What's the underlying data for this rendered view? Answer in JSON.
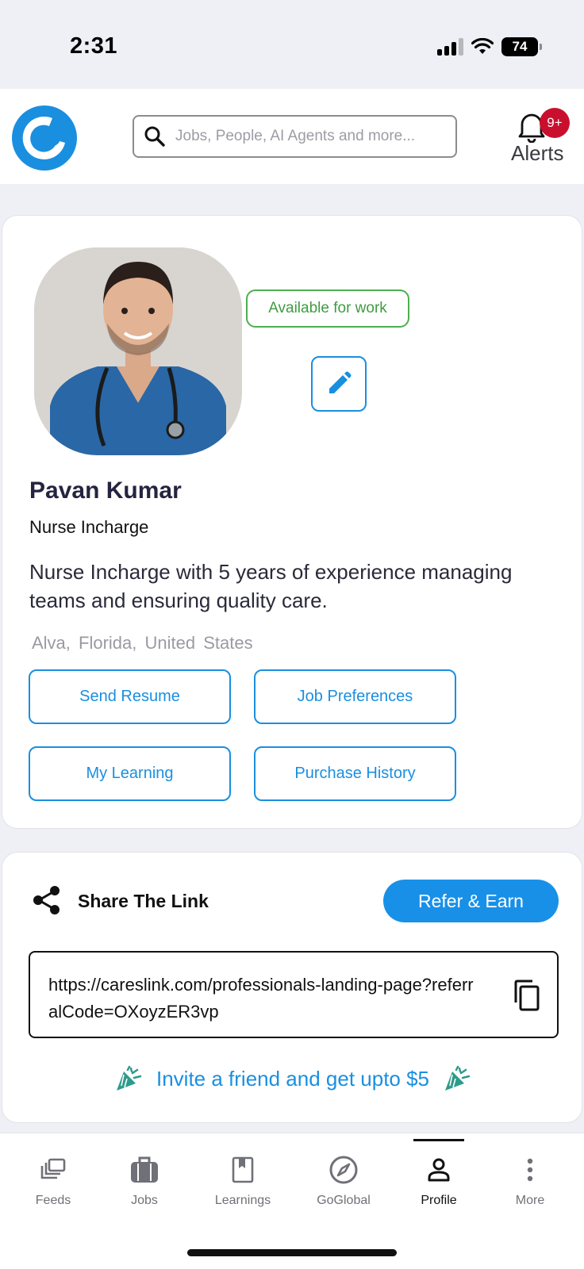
{
  "status_bar": {
    "time": "2:31",
    "battery": "74"
  },
  "header": {
    "search_placeholder": "Jobs, People, AI Agents and more...",
    "alerts_label": "Alerts",
    "alerts_badge": "9+"
  },
  "profile": {
    "availability": "Available for work",
    "name": "Pavan Kumar",
    "title": "Nurse Incharge",
    "bio": "Nurse Incharge with 5 years of experience managing teams and ensuring quality care.",
    "location": "Alva,  Florida,  United States",
    "actions": {
      "send_resume": "Send Resume",
      "job_preferences": "Job Preferences",
      "my_learning": "My Learning",
      "purchase_history": "Purchase History"
    }
  },
  "share": {
    "title": "Share The Link",
    "refer_button": "Refer & Earn",
    "link": "https://careslink.com/professionals-landing-page?referralCode=OXoyzER3vp",
    "invite_text": "Invite a friend and get upto $5"
  },
  "nav": {
    "feeds": "Feeds",
    "jobs": "Jobs",
    "learnings": "Learnings",
    "goglobal": "GoGlobal",
    "profile": "Profile",
    "more": "More"
  },
  "colors": {
    "brand_blue": "#1a8fe0",
    "available_green": "#4caf50",
    "badge_red": "#c8102e",
    "invite_icon_teal": "#2e9a8a"
  },
  "icons": [
    "search-icon",
    "bell-icon",
    "edit-pencil-icon",
    "share-icon",
    "copy-icon",
    "party-popper-icon",
    "feeds-icon",
    "briefcase-icon",
    "book-icon",
    "compass-icon",
    "person-icon",
    "more-vertical-icon"
  ]
}
